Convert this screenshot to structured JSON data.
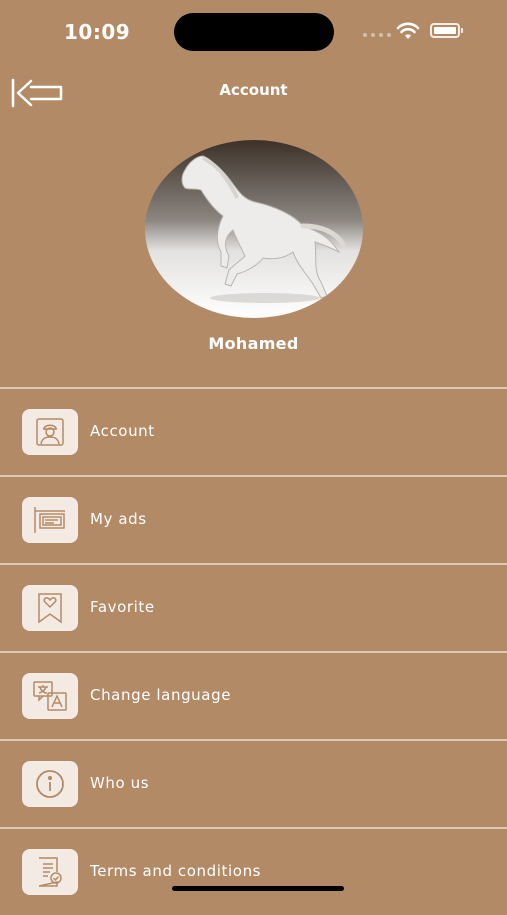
{
  "status_bar": {
    "time": "10:09"
  },
  "header": {
    "title": "Account"
  },
  "profile": {
    "name": "Mohamed"
  },
  "menu": [
    {
      "label": "Account",
      "icon": "user-icon"
    },
    {
      "label": "My ads",
      "icon": "ads-sign-icon"
    },
    {
      "label": "Favorite",
      "icon": "bookmark-heart-icon"
    },
    {
      "label": "Change language",
      "icon": "translate-icon"
    },
    {
      "label": "Who us",
      "icon": "info-icon"
    },
    {
      "label": "Terms and conditions",
      "icon": "terms-document-icon"
    }
  ],
  "colors": {
    "background": "#b38a66",
    "icon_tile": "#f3ebe3",
    "icon_stroke": "#b38a66"
  }
}
